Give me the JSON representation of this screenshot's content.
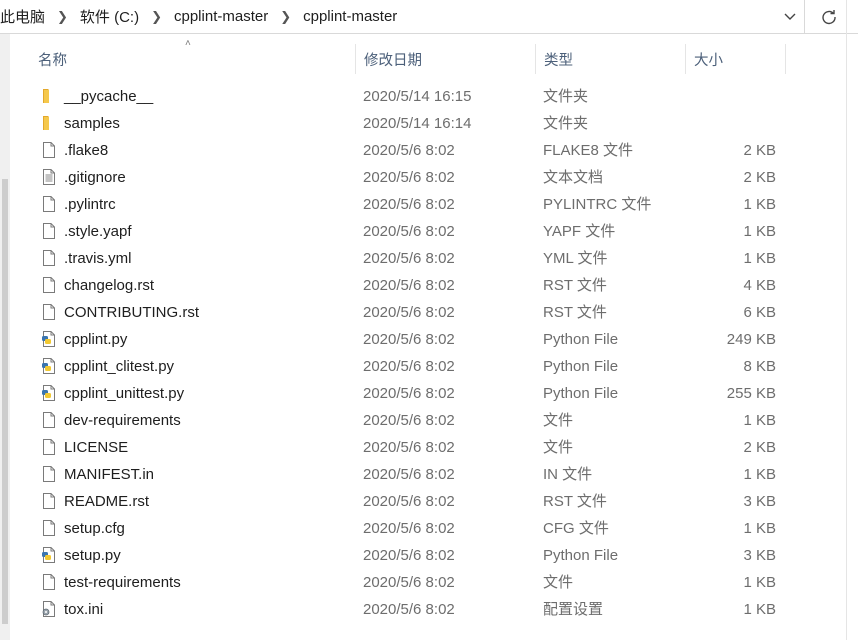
{
  "address": {
    "crumbs": [
      "此电脑",
      "软件 (C:)",
      "cpplint-master",
      "cpplint-master"
    ]
  },
  "columns": {
    "name": "名称",
    "date": "修改日期",
    "type": "类型",
    "size": "大小"
  },
  "files": [
    {
      "icon": "folder-icon",
      "name": "__pycache__",
      "date": "2020/5/14 16:15",
      "type": "文件夹",
      "size": ""
    },
    {
      "icon": "folder-icon",
      "name": "samples",
      "date": "2020/5/14 16:14",
      "type": "文件夹",
      "size": ""
    },
    {
      "icon": "file-icon",
      "name": ".flake8",
      "date": "2020/5/6 8:02",
      "type": "FLAKE8 文件",
      "size": "2 KB"
    },
    {
      "icon": "text-file-icon",
      "name": ".gitignore",
      "date": "2020/5/6 8:02",
      "type": "文本文档",
      "size": "2 KB"
    },
    {
      "icon": "file-icon",
      "name": ".pylintrc",
      "date": "2020/5/6 8:02",
      "type": "PYLINTRC 文件",
      "size": "1 KB"
    },
    {
      "icon": "file-icon",
      "name": ".style.yapf",
      "date": "2020/5/6 8:02",
      "type": "YAPF 文件",
      "size": "1 KB"
    },
    {
      "icon": "file-icon",
      "name": ".travis.yml",
      "date": "2020/5/6 8:02",
      "type": "YML 文件",
      "size": "1 KB"
    },
    {
      "icon": "file-icon",
      "name": "changelog.rst",
      "date": "2020/5/6 8:02",
      "type": "RST 文件",
      "size": "4 KB"
    },
    {
      "icon": "file-icon",
      "name": "CONTRIBUTING.rst",
      "date": "2020/5/6 8:02",
      "type": "RST 文件",
      "size": "6 KB"
    },
    {
      "icon": "python-file-icon",
      "name": "cpplint.py",
      "date": "2020/5/6 8:02",
      "type": "Python File",
      "size": "249 KB"
    },
    {
      "icon": "python-file-icon",
      "name": "cpplint_clitest.py",
      "date": "2020/5/6 8:02",
      "type": "Python File",
      "size": "8 KB"
    },
    {
      "icon": "python-file-icon",
      "name": "cpplint_unittest.py",
      "date": "2020/5/6 8:02",
      "type": "Python File",
      "size": "255 KB"
    },
    {
      "icon": "file-icon",
      "name": "dev-requirements",
      "date": "2020/5/6 8:02",
      "type": "文件",
      "size": "1 KB"
    },
    {
      "icon": "file-icon",
      "name": "LICENSE",
      "date": "2020/5/6 8:02",
      "type": "文件",
      "size": "2 KB"
    },
    {
      "icon": "file-icon",
      "name": "MANIFEST.in",
      "date": "2020/5/6 8:02",
      "type": "IN 文件",
      "size": "1 KB"
    },
    {
      "icon": "file-icon",
      "name": "README.rst",
      "date": "2020/5/6 8:02",
      "type": "RST 文件",
      "size": "3 KB"
    },
    {
      "icon": "file-icon",
      "name": "setup.cfg",
      "date": "2020/5/6 8:02",
      "type": "CFG 文件",
      "size": "1 KB"
    },
    {
      "icon": "python-file-icon",
      "name": "setup.py",
      "date": "2020/5/6 8:02",
      "type": "Python File",
      "size": "3 KB"
    },
    {
      "icon": "file-icon",
      "name": "test-requirements",
      "date": "2020/5/6 8:02",
      "type": "文件",
      "size": "1 KB"
    },
    {
      "icon": "settings-file-icon",
      "name": "tox.ini",
      "date": "2020/5/6 8:02",
      "type": "配置设置",
      "size": "1 KB"
    }
  ],
  "colors": {
    "folder": "#e8b536",
    "header_text": "#4c607a",
    "detail_text": "#6d6d6d"
  }
}
